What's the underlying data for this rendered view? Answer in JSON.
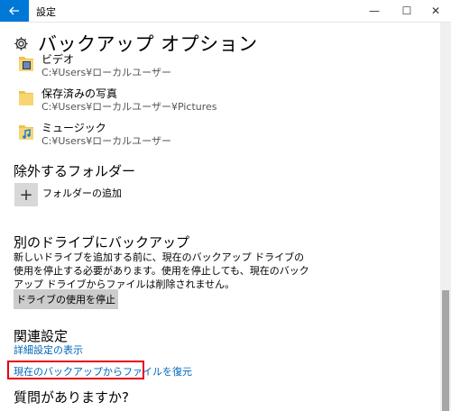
{
  "window": {
    "title": "設定",
    "controls": {
      "minimize": "—",
      "maximize": "☐",
      "close": "✕"
    }
  },
  "page": {
    "title": "バックアップ オプション"
  },
  "folders": [
    {
      "name": "ビデオ",
      "path": "C:¥Users¥ローカルユーザー",
      "icon": "video-folder-icon"
    },
    {
      "name": "保存済みの写真",
      "path": "C:¥Users¥ローカルユーザー¥Pictures",
      "icon": "folder-icon"
    },
    {
      "name": "ミュージック",
      "path": "C:¥Users¥ローカルユーザー",
      "icon": "music-folder-icon"
    }
  ],
  "exclude": {
    "heading": "除外するフォルダー",
    "add_symbol": "+",
    "add_label": "フォルダーの追加"
  },
  "other_drive": {
    "heading": "別のドライブにバックアップ",
    "description": "新しいドライブを追加する前に、現在のバックアップ ドライブの使用を停止する必要があります。使用を停止しても、現在のバックアップ ドライブからファイルは削除されません。",
    "button": "ドライブの使用を停止"
  },
  "related": {
    "heading": "関連設定",
    "link_details": "詳細設定の表示",
    "link_restore": "現在のバックアップからファイルを復元"
  },
  "question": {
    "heading": "質問がありますか?"
  },
  "colors": {
    "accent": "#0078d7",
    "link": "#0067b8",
    "highlight": "#e60012"
  }
}
